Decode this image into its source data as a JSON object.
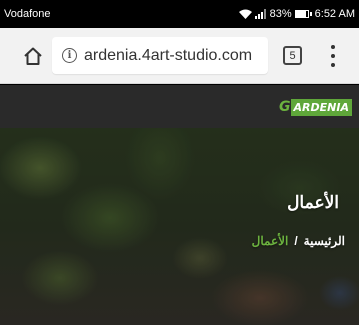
{
  "status_bar": {
    "carrier": "Vodafone",
    "battery_percent": "83%",
    "time": "6:52 AM",
    "battery_level": 0.83
  },
  "browser": {
    "url": "ardenia.4art-studio.com",
    "tab_count": "5",
    "icons": {
      "home": "home-icon",
      "info": "info-icon",
      "menu": "more-vert-icon"
    }
  },
  "site": {
    "logo": {
      "initial": "G",
      "text": "ARDENIA"
    },
    "colors": {
      "header_bg": "#2a2a2a",
      "accent": "#6cb33f"
    }
  },
  "hero": {
    "title": "الأعمال",
    "breadcrumb": {
      "home": "الرئيسية",
      "separator": "/",
      "current": "الأعمال"
    }
  }
}
